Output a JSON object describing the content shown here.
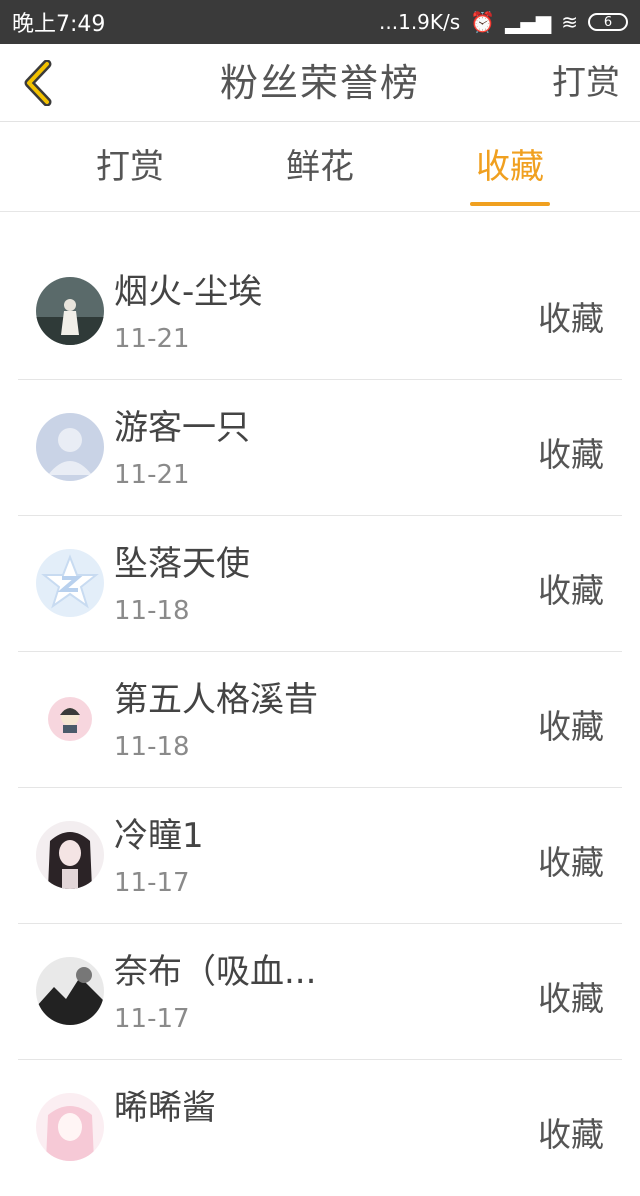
{
  "status_bar": {
    "time": "晚上7:49",
    "network": "...1.9K/s",
    "battery": "6"
  },
  "header": {
    "title": "粉丝荣誉榜",
    "right_action": "打赏"
  },
  "tabs": [
    {
      "label": "打赏"
    },
    {
      "label": "鲜花"
    },
    {
      "label": "收藏"
    }
  ],
  "active_tab": "收藏",
  "fans": [
    {
      "name": "烟火-尘埃",
      "date": "11-21",
      "action": "收藏"
    },
    {
      "name": "游客一只",
      "date": "11-21",
      "action": "收藏"
    },
    {
      "name": "坠落天使",
      "date": "11-18",
      "action": "收藏"
    },
    {
      "name": "第五人格溪昔",
      "date": "11-18",
      "action": "收藏"
    },
    {
      "name": "冷瞳1",
      "date": "11-17",
      "action": "收藏"
    },
    {
      "name": "奈布（吸血...",
      "date": "11-17",
      "action": "收藏"
    },
    {
      "name": "晞晞酱",
      "date": "",
      "action": "收藏"
    }
  ],
  "colors": {
    "accent": "#f0a020",
    "status_bar": "#3a3a3a",
    "divider": "#e5e5e5"
  }
}
